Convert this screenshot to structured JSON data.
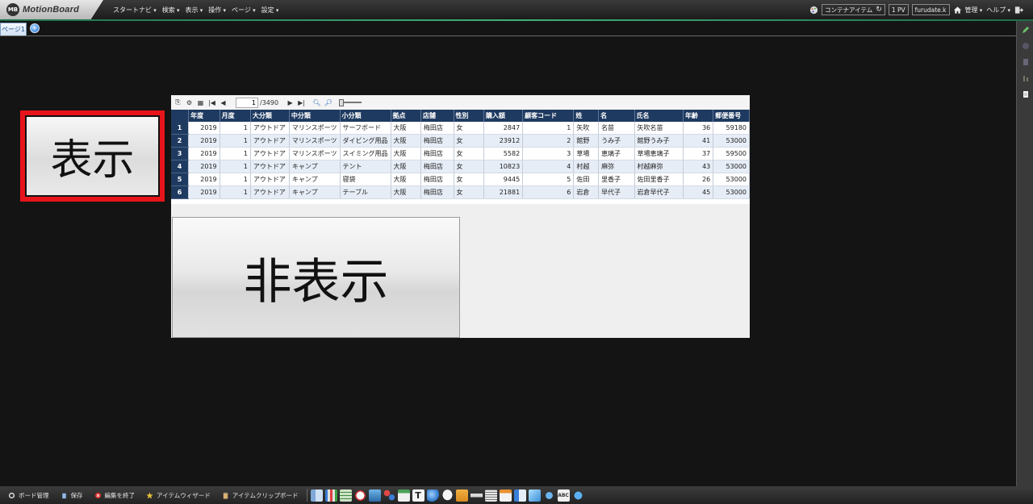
{
  "app": {
    "logo_badge": "MB",
    "logo_text": "MotionBoard",
    "menu": [
      "スタートナビ",
      "検索",
      "表示",
      "操作",
      "ページ",
      "設定"
    ]
  },
  "header_right": {
    "container_item": "コンテナアイテム",
    "pv": "1 PV",
    "user": "furudate.k",
    "menus": [
      "管理",
      "ヘルプ"
    ]
  },
  "tabs": {
    "active": "ページ1",
    "add_icon": "plus-circle-icon"
  },
  "show_button": {
    "label": "表示"
  },
  "hide_button": {
    "label": "非表示"
  },
  "pager": {
    "current": "1",
    "total": "/3490",
    "first": "|◀",
    "prev": "◀",
    "next": "▶",
    "last": "▶|"
  },
  "table": {
    "columns": [
      "年度",
      "月度",
      "大分類",
      "中分類",
      "小分類",
      "拠点",
      "店舗",
      "性別",
      "購入額",
      "顧客コード",
      "姓",
      "名",
      "氏名",
      "年齢",
      "郵便番号"
    ],
    "rows": [
      [
        "1",
        "2019",
        "1",
        "アウトドア",
        "マリンスポーツ",
        "サーフボード",
        "大阪",
        "梅田店",
        "女",
        "2847",
        "1",
        "矢吹",
        "名苗",
        "矢吹名苗",
        "36",
        "59180"
      ],
      [
        "2",
        "2019",
        "1",
        "アウトドア",
        "マリンスポーツ",
        "ダイビング用品",
        "大阪",
        "梅田店",
        "女",
        "23912",
        "2",
        "館野",
        "うみ子",
        "館野うみ子",
        "41",
        "53000"
      ],
      [
        "3",
        "2019",
        "1",
        "アウトドア",
        "マリンスポーツ",
        "スイミング用品",
        "大阪",
        "梅田店",
        "女",
        "5582",
        "3",
        "草場",
        "恵璃子",
        "草場恵璃子",
        "37",
        "59500"
      ],
      [
        "4",
        "2019",
        "1",
        "アウトドア",
        "キャンプ",
        "テント",
        "大阪",
        "梅田店",
        "女",
        "10823",
        "4",
        "村越",
        "麻弥",
        "村越麻弥",
        "43",
        "53000"
      ],
      [
        "5",
        "2019",
        "1",
        "アウトドア",
        "キャンプ",
        "寝袋",
        "大阪",
        "梅田店",
        "女",
        "9445",
        "5",
        "佐田",
        "里香子",
        "佐田里香子",
        "26",
        "53000"
      ],
      [
        "6",
        "2019",
        "1",
        "アウトドア",
        "キャンプ",
        "テーブル",
        "大阪",
        "梅田店",
        "女",
        "21881",
        "6",
        "岩倉",
        "早代子",
        "岩倉早代子",
        "45",
        "53000"
      ]
    ]
  },
  "bottom_bar": {
    "items": [
      {
        "label": "ボード管理",
        "icon": "gear-icon"
      },
      {
        "label": "保存",
        "icon": "trash-icon"
      },
      {
        "label": "編集を終了",
        "icon": "close-circle-icon"
      },
      {
        "label": "アイテムウィザード",
        "icon": "star-icon"
      },
      {
        "label": "アイテムクリップボード",
        "icon": "clipboard-icon"
      }
    ],
    "palette_icons": [
      "layout-icon",
      "bar-chart-icon",
      "grid-table-icon",
      "clock-icon",
      "image-icon",
      "puzzle-icon",
      "report-icon",
      "text-icon",
      "globe-icon",
      "speech-bubble-icon",
      "folder-icon",
      "input-icon",
      "list-icon",
      "form-icon",
      "document-icon",
      "cube-icon",
      "airplane-icon",
      "abc-icon",
      "plugin-icon"
    ]
  },
  "colors": {
    "background": "#141414",
    "header_accent": "#3fb07a",
    "table_header": "#1f3a60",
    "highlight_frame": "#e8141b"
  }
}
